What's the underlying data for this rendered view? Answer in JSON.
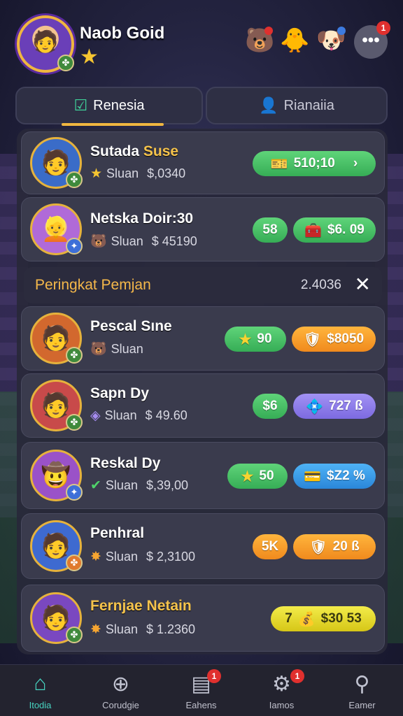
{
  "header": {
    "player_name": "Naob Goid",
    "more_badge": "1",
    "more_label": "•••"
  },
  "tabs": [
    {
      "label": "Renesia",
      "active": true
    },
    {
      "label": "Rianaiia",
      "active": false
    }
  ],
  "top_players": [
    {
      "name": "Sutada",
      "name_highlight": "Suse",
      "sub_label": "Sluan",
      "amount": "$,0340",
      "pill": {
        "text": "510;10",
        "color": "green",
        "arrow": "›"
      }
    },
    {
      "name": "Netska Doir:30",
      "sub_label": "Sluan",
      "amount": "$ 45190",
      "pill_left": {
        "text": "58",
        "color": "green"
      },
      "pill_right": {
        "text": "$6. 09",
        "color": "green"
      }
    }
  ],
  "section": {
    "title": "Peringkat Pemjan",
    "count": "2.4036",
    "close": "✕"
  },
  "ranking": [
    {
      "name": "Pescal Sıne",
      "sub_label": "Sluan",
      "amount": "",
      "pill_left": {
        "text": "90",
        "color": "green"
      },
      "pill_right": {
        "text": "$8050",
        "color": "orange"
      }
    },
    {
      "name": "Sapn Dy",
      "sub_label": "Sluan",
      "amount": "$ 49.60",
      "pill_left": {
        "text": "$6",
        "color": "green"
      },
      "pill_right": {
        "text": "727  ß",
        "color": "purple"
      }
    },
    {
      "name": "Reskal Dy",
      "sub_label": "Sluan",
      "amount": "$,39,00",
      "pill_left": {
        "text": "50",
        "color": "green"
      },
      "pill_right": {
        "text": "$Z2  %",
        "color": "blue"
      }
    },
    {
      "name": "Penhral",
      "sub_label": "Sluan",
      "amount": "$ 2,3100",
      "pill_left": {
        "text": "5K",
        "color": "orange"
      },
      "pill_right": {
        "text": "20  ß",
        "color": "orange"
      }
    },
    {
      "name": "Fernjae Netain",
      "sub_label": "Sluan",
      "amount": "$ 1.2360",
      "pill": {
        "text": "$30 53",
        "color": "yellow",
        "prefix": "7"
      }
    }
  ],
  "nav": [
    {
      "label": "Itodia",
      "active": true,
      "icon": "home-icon"
    },
    {
      "label": "Corudgie",
      "active": false,
      "icon": "search-icon"
    },
    {
      "label": "Eahens",
      "active": false,
      "icon": "inbox-icon",
      "badge": "1"
    },
    {
      "label": "Iamos",
      "active": false,
      "icon": "gear-icon",
      "badge": "1"
    },
    {
      "label": "Eamer",
      "active": false,
      "icon": "profile-icon"
    }
  ],
  "colors": {
    "accent_gold": "#f0b640",
    "accent_teal": "#47d3c0",
    "pill_green": "#36ad56",
    "pill_orange": "#f08a1d",
    "pill_blue": "#2a86d9",
    "pill_purple": "#7c6ae0",
    "pill_yellow": "#d6c617"
  }
}
